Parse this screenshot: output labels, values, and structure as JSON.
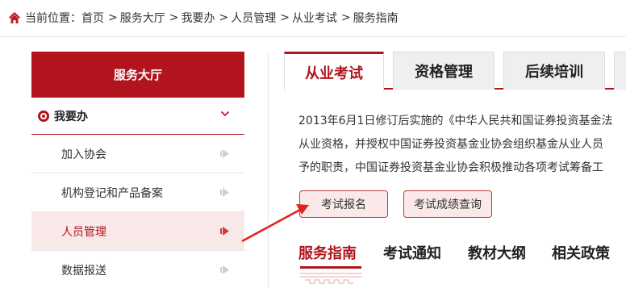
{
  "breadcrumb": {
    "prefix": "当前位置：",
    "items": [
      "首页",
      "服务大厅",
      "我要办",
      "人员管理",
      "从业考试",
      "服务指南"
    ],
    "separator": ">"
  },
  "sidebar": {
    "header": "服务大厅",
    "group_label": "我要办",
    "items": [
      {
        "label": "加入协会"
      },
      {
        "label": "机构登记和产品备案"
      },
      {
        "label": "人员管理"
      },
      {
        "label": "数据报送"
      }
    ],
    "active_item": "人员管理"
  },
  "tabs": [
    "从业考试",
    "资格管理",
    "后续培训"
  ],
  "active_tab": "从业考试",
  "content": {
    "lines": [
      "2013年6月1日修订后实施的《中华人民共和国证券投资基金法",
      "从业资格，并授权中国证券投资基金业协会组织基金从业人员",
      "予的职责，中国证券投资基金业协会积极推动各项考试筹备工"
    ]
  },
  "buttons": {
    "register": "考试报名",
    "score_query": "考试成绩查询"
  },
  "bottom_nav": [
    "服务指南",
    "考试通知",
    "教材大纲",
    "相关政策"
  ],
  "colors": {
    "brand_red": "#b1141c",
    "active_bg": "#f8e8e8",
    "button_bg": "#fbe9e9"
  },
  "icons": {
    "breadcrumb": "home-icon",
    "group": "radio-icon",
    "expand": "chevron-down-icon",
    "item": "arrow-right-icon",
    "annotation": "annotation-arrow"
  }
}
